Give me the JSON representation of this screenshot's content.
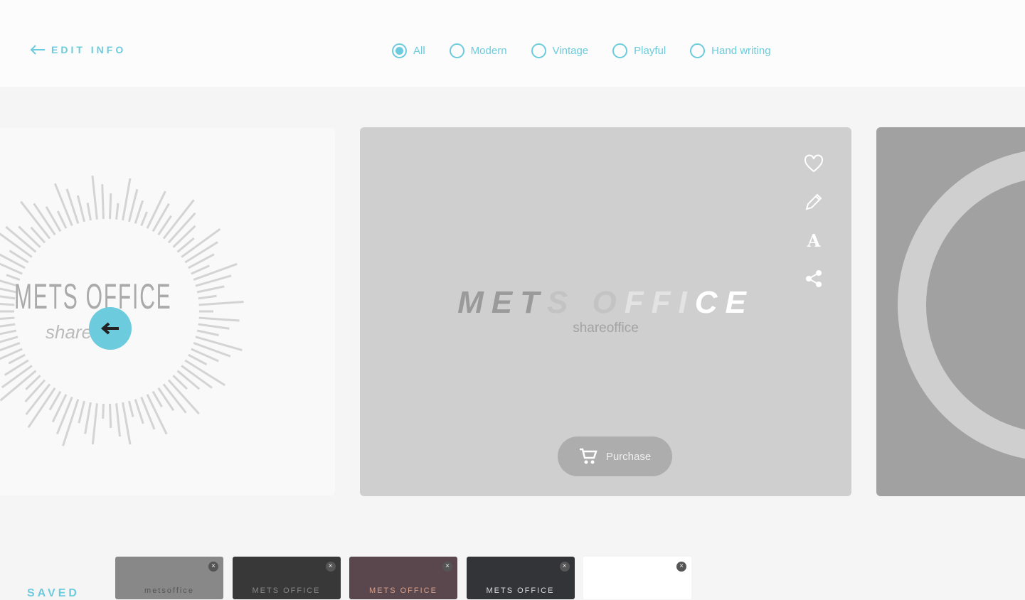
{
  "header": {
    "back_label": "EDIT INFO",
    "filters": [
      {
        "label": "All",
        "selected": true
      },
      {
        "label": "Modern",
        "selected": false
      },
      {
        "label": "Vintage",
        "selected": false
      },
      {
        "label": "Playful",
        "selected": false
      },
      {
        "label": "Hand writing",
        "selected": false
      }
    ]
  },
  "carousel": {
    "prev_card": {
      "logo": "METS OFFICE",
      "sub": "share"
    },
    "current_card": {
      "logo_parts": [
        {
          "text": "MET",
          "color": "#9a9a9a"
        },
        {
          "text": "S O",
          "color": "#c3c3c3"
        },
        {
          "text": "FFI",
          "color": "#e3e3e3"
        },
        {
          "text": "CE",
          "color": "#ffffff"
        }
      ],
      "sub": "shareoffice",
      "purchase_label": "Purchase",
      "tools": [
        "heart-icon",
        "pencil-icon",
        "font-icon",
        "share-icon"
      ]
    }
  },
  "saved": {
    "label": "SAVED",
    "items": [
      {
        "text": "metsoffice",
        "bg": "#888888",
        "fg": "#555555"
      },
      {
        "text": "METS OFFICE",
        "bg": "#383838",
        "fg": "#888888"
      },
      {
        "text": "METS OFFICE",
        "bg": "#5a474d",
        "fg": "#d9a08a"
      },
      {
        "text": "METS OFFICE",
        "bg": "#333438",
        "fg": "#dddddd"
      },
      {
        "text": "",
        "bg": "#ffffff",
        "fg": "#cccccc"
      }
    ]
  },
  "colors": {
    "accent": "#6ccbdc"
  }
}
